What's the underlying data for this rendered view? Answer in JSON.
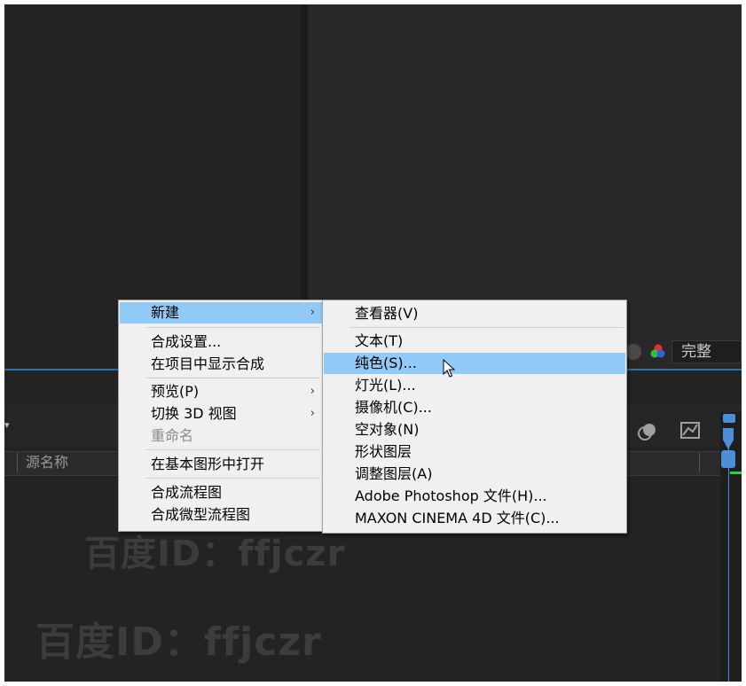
{
  "viewer": {
    "resolution_value": "完整"
  },
  "timeline": {
    "source_name_header": "源名称"
  },
  "context_menu": {
    "items": [
      {
        "label": "新建",
        "has_submenu": true,
        "highlighted": true
      },
      {
        "label": "合成设置..."
      },
      {
        "label": "在项目中显示合成"
      },
      {
        "label": "预览(P)",
        "has_submenu": true
      },
      {
        "label": "切换 3D 视图",
        "has_submenu": true
      },
      {
        "label": "重命名",
        "disabled": true
      },
      {
        "label": "在基本图形中打开"
      },
      {
        "label": "合成流程图"
      },
      {
        "label": "合成微型流程图"
      }
    ]
  },
  "submenu": {
    "items": [
      {
        "label": "查看器(V)"
      },
      {
        "label": "文本(T)"
      },
      {
        "label": "纯色(S)...",
        "highlighted": true
      },
      {
        "label": "灯光(L)..."
      },
      {
        "label": "摄像机(C)..."
      },
      {
        "label": "空对象(N)"
      },
      {
        "label": "形状图层"
      },
      {
        "label": "调整图层(A)"
      },
      {
        "label": "Adobe Photoshop 文件(H)..."
      },
      {
        "label": "MAXON CINEMA 4D 文件(C)..."
      }
    ]
  },
  "watermarks": [
    "百度ID：ffjczr",
    "百度ID：ffjczr",
    "百度ID：ffjczr"
  ],
  "colors": {
    "highlight": "#91c9f7",
    "accent_blue": "#4a8fd8",
    "menu_bg": "#f0f0f0",
    "panel_bg": "#232323"
  }
}
